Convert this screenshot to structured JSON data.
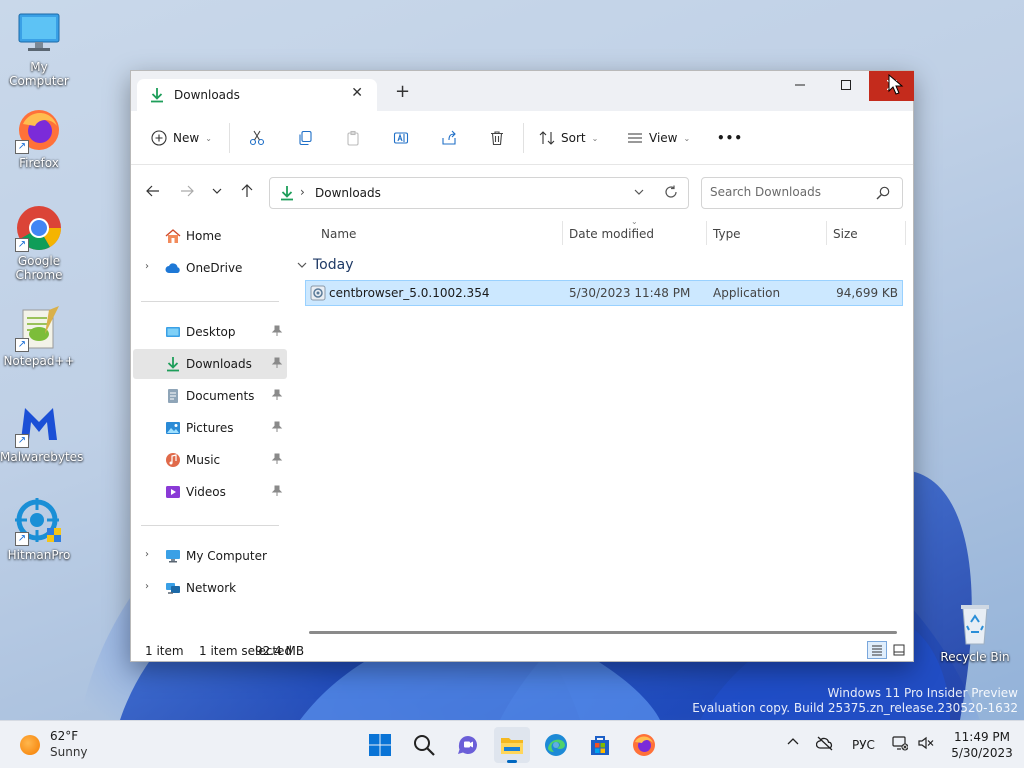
{
  "desktop": {
    "icons": [
      {
        "label": "My Computer"
      },
      {
        "label": "Firefox"
      },
      {
        "label": "Google Chrome"
      },
      {
        "label": "Notepad++"
      },
      {
        "label": "Malwarebytes"
      },
      {
        "label": "HitmanPro"
      },
      {
        "label": "Recycle Bin"
      }
    ],
    "watermark": {
      "line1": "Windows 11 Pro Insider Preview",
      "line2": "Evaluation copy. Build 25375.zn_release.230520-1632"
    }
  },
  "window": {
    "tab_title": "Downloads",
    "toolbar": {
      "new_label": "New",
      "sort_label": "Sort",
      "view_label": "View",
      "more_label": "•••"
    },
    "address": {
      "path": "Downloads",
      "search_placeholder": "Search Downloads"
    },
    "sidebar": {
      "home": "Home",
      "onedrive": "OneDrive",
      "desktop": "Desktop",
      "downloads": "Downloads",
      "documents": "Documents",
      "pictures": "Pictures",
      "music": "Music",
      "videos": "Videos",
      "mycomputer": "My Computer",
      "network": "Network"
    },
    "columns": {
      "name": "Name",
      "date": "Date modified",
      "type": "Type",
      "size": "Size"
    },
    "group": "Today",
    "files": [
      {
        "name": "centbrowser_5.0.1002.354",
        "date": "5/30/2023 11:48 PM",
        "type": "Application",
        "size": "94,699 KB"
      }
    ],
    "status": {
      "count": "1 item",
      "selected": "1 item selected",
      "size": "92.4 MB"
    }
  },
  "taskbar": {
    "weather": {
      "temp": "62°F",
      "condition": "Sunny"
    },
    "language": "РУС",
    "time": "11:49 PM",
    "date": "5/30/2023"
  },
  "colors": {
    "accent": "#0067c0",
    "selection": "#cce8ff",
    "close_red": "#c42b1c",
    "downloads_green": "#1e9e5a"
  }
}
